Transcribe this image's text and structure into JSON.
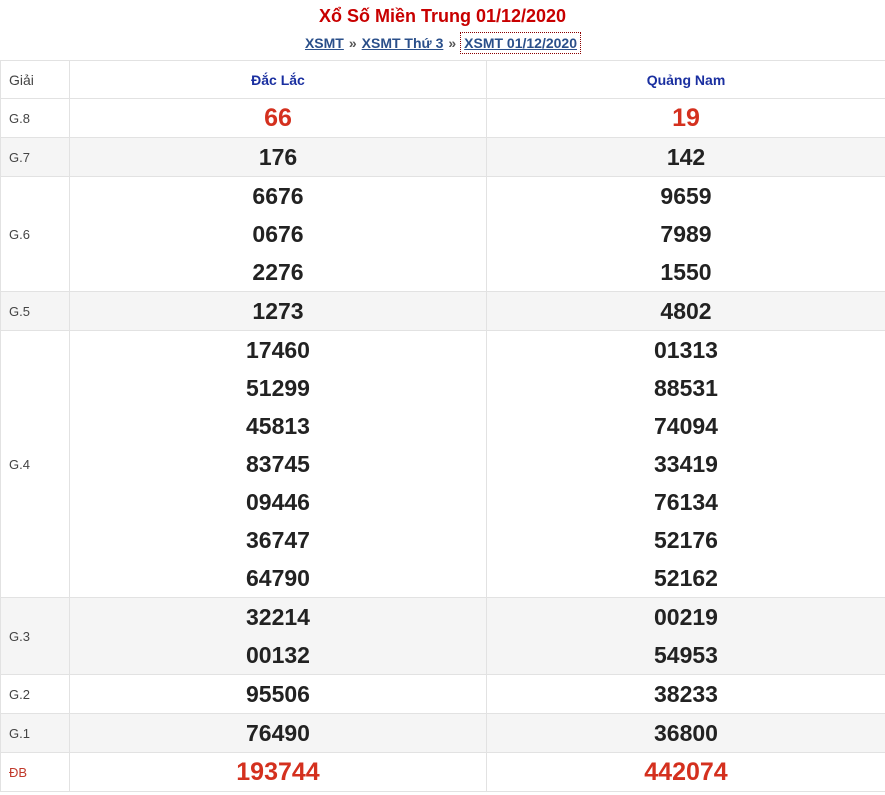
{
  "title": "Xổ Số Miền Trung 01/12/2020",
  "breadcrumb": [
    "XSMT",
    "XSMT Thứ 3",
    "XSMT 01/12/2020"
  ],
  "breadcrumb_sep": "»",
  "table": {
    "header": [
      "Giải",
      "Đắc Lắc",
      "Quảng Nam"
    ],
    "rows": [
      {
        "label": "G.8",
        "a": [
          "66"
        ],
        "b": [
          "19"
        ],
        "highlight": true,
        "alt": false
      },
      {
        "label": "G.7",
        "a": [
          "176"
        ],
        "b": [
          "142"
        ],
        "highlight": false,
        "alt": true
      },
      {
        "label": "G.6",
        "a": [
          "6676",
          "0676",
          "2276"
        ],
        "b": [
          "9659",
          "7989",
          "1550"
        ],
        "highlight": false,
        "alt": false
      },
      {
        "label": "G.5",
        "a": [
          "1273"
        ],
        "b": [
          "4802"
        ],
        "highlight": false,
        "alt": true
      },
      {
        "label": "G.4",
        "a": [
          "17460",
          "51299",
          "45813",
          "83745",
          "09446",
          "36747",
          "64790"
        ],
        "b": [
          "01313",
          "88531",
          "74094",
          "33419",
          "76134",
          "52176",
          "52162"
        ],
        "highlight": false,
        "alt": false
      },
      {
        "label": "G.3",
        "a": [
          "32214",
          "00132"
        ],
        "b": [
          "00219",
          "54953"
        ],
        "highlight": false,
        "alt": true
      },
      {
        "label": "G.2",
        "a": [
          "95506"
        ],
        "b": [
          "38233"
        ],
        "highlight": false,
        "alt": false
      },
      {
        "label": "G.1",
        "a": [
          "76490"
        ],
        "b": [
          "36800"
        ],
        "highlight": false,
        "alt": true
      },
      {
        "label": "ĐB",
        "a": [
          "193744"
        ],
        "b": [
          "442074"
        ],
        "highlight": true,
        "alt": false
      }
    ]
  }
}
